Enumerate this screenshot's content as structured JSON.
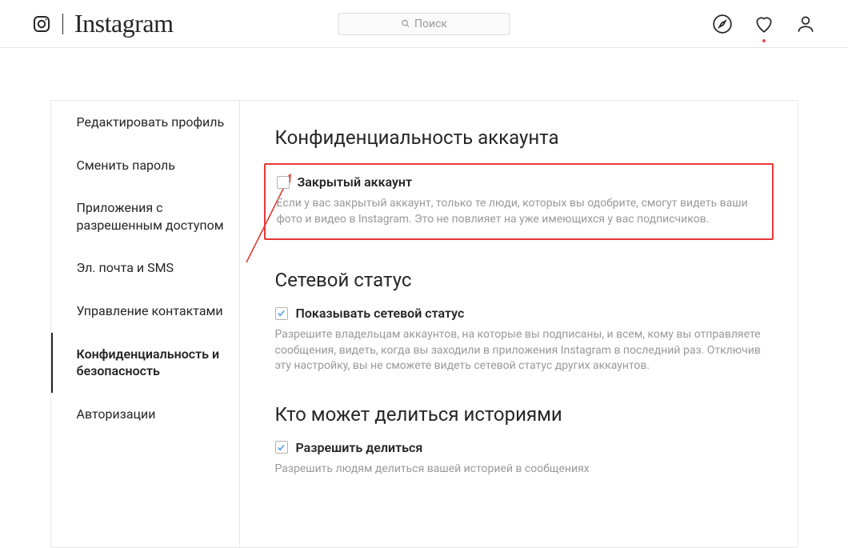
{
  "header": {
    "wordmark": "Instagram",
    "search_placeholder": "Поиск"
  },
  "sidebar": {
    "items": [
      {
        "label": "Редактировать профиль"
      },
      {
        "label": "Сменить пароль"
      },
      {
        "label": "Приложения с разрешенным доступом"
      },
      {
        "label": "Эл. почта и SMS"
      },
      {
        "label": "Управление контактами"
      },
      {
        "label": "Конфиденциальность и безопасность"
      },
      {
        "label": "Авторизации"
      }
    ]
  },
  "sections": {
    "privacy": {
      "title": "Конфиденциальность аккаунта",
      "toggle_label": "Закрытый аккаунт",
      "desc": "Если у вас закрытый аккаунт, только те люди, которых вы одобрите, смогут видеть ваши фото и видео в Instagram. Это не повлияет на уже имеющихся у вас подписчиков."
    },
    "activity": {
      "title": "Сетевой статус",
      "toggle_label": "Показывать сетевой статус",
      "desc": "Разрешите владельцам аккаунтов, на которые вы подписаны, и всем, кому вы отправляете сообщения, видеть, когда вы заходили в приложения Instagram в последний раз. Отключив эту настройку, вы не сможете видеть сетевой статус других аккаунтов."
    },
    "story": {
      "title": "Кто может делиться историями",
      "toggle_label": "Разрешить делиться",
      "desc": "Разрешить людям делиться вашей историей в сообщениях"
    }
  }
}
